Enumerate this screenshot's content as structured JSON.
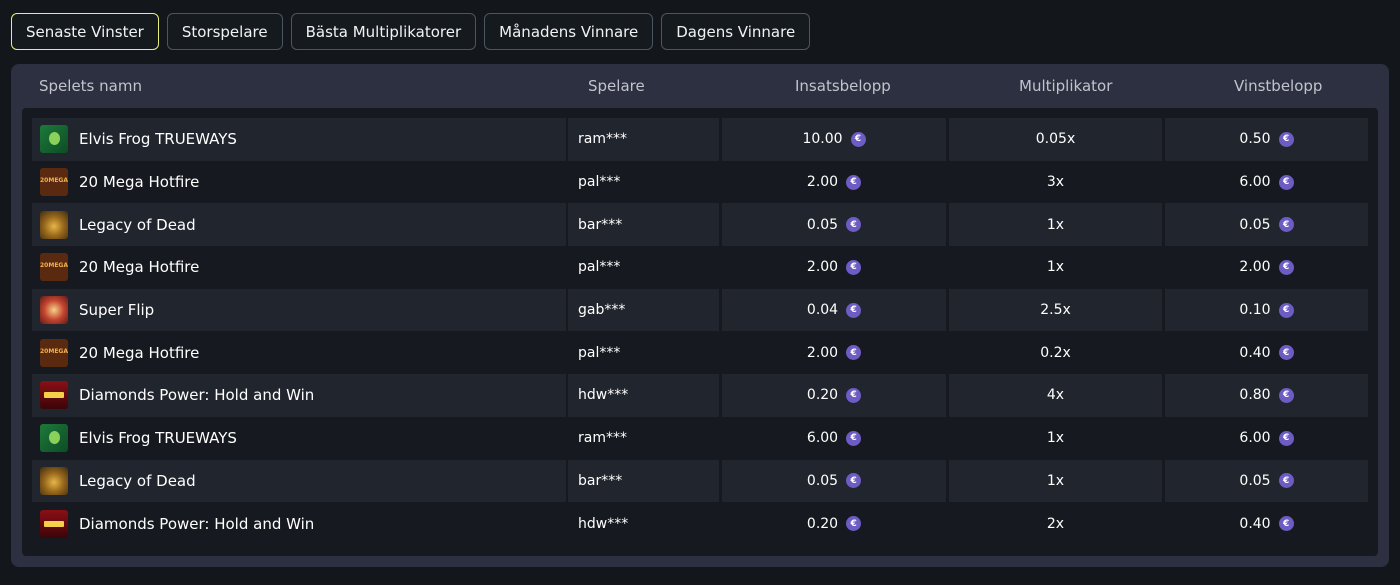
{
  "tabs": [
    {
      "label": "Senaste Vinster",
      "active": true
    },
    {
      "label": "Storspelare",
      "active": false
    },
    {
      "label": "Bästa Multiplikatorer",
      "active": false
    },
    {
      "label": "Månadens Vinnare",
      "active": false
    },
    {
      "label": "Dagens Vinnare",
      "active": false
    }
  ],
  "table": {
    "headers": {
      "game": "Spelets namn",
      "player": "Spelare",
      "bet": "Insatsbelopp",
      "multiplier": "Multiplikator",
      "win": "Vinstbelopp"
    },
    "currency_icon": "euro-coin-icon",
    "currency_symbol": "€",
    "rows": [
      {
        "game": "Elvis Frog TRUEWAYS",
        "thumb": "frog",
        "player": "ram***",
        "bet": "10.00",
        "multiplier": "0.05x",
        "win": "0.50"
      },
      {
        "game": "20 Mega Hotfire",
        "thumb": "hot",
        "player": "pal***",
        "bet": "2.00",
        "multiplier": "3x",
        "win": "6.00"
      },
      {
        "game": "Legacy of Dead",
        "thumb": "legacy",
        "player": "bar***",
        "bet": "0.05",
        "multiplier": "1x",
        "win": "0.05"
      },
      {
        "game": "20 Mega Hotfire",
        "thumb": "hot",
        "player": "pal***",
        "bet": "2.00",
        "multiplier": "1x",
        "win": "2.00"
      },
      {
        "game": "Super Flip",
        "thumb": "flip",
        "player": "gab***",
        "bet": "0.04",
        "multiplier": "2.5x",
        "win": "0.10"
      },
      {
        "game": "20 Mega Hotfire",
        "thumb": "hot",
        "player": "pal***",
        "bet": "2.00",
        "multiplier": "0.2x",
        "win": "0.40"
      },
      {
        "game": "Diamonds Power: Hold and Win",
        "thumb": "diamond",
        "player": "hdw***",
        "bet": "0.20",
        "multiplier": "4x",
        "win": "0.80"
      },
      {
        "game": "Elvis Frog TRUEWAYS",
        "thumb": "frog",
        "player": "ram***",
        "bet": "6.00",
        "multiplier": "1x",
        "win": "6.00"
      },
      {
        "game": "Legacy of Dead",
        "thumb": "legacy",
        "player": "bar***",
        "bet": "0.05",
        "multiplier": "1x",
        "win": "0.05"
      },
      {
        "game": "Diamonds Power: Hold and Win",
        "thumb": "diamond",
        "player": "hdw***",
        "bet": "0.20",
        "multiplier": "2x",
        "win": "0.40"
      }
    ]
  },
  "colors": {
    "background": "#13171c",
    "panel": "#2c3040",
    "active_tab_border": "#e6ef7b",
    "coin": "#6c5cc4"
  }
}
